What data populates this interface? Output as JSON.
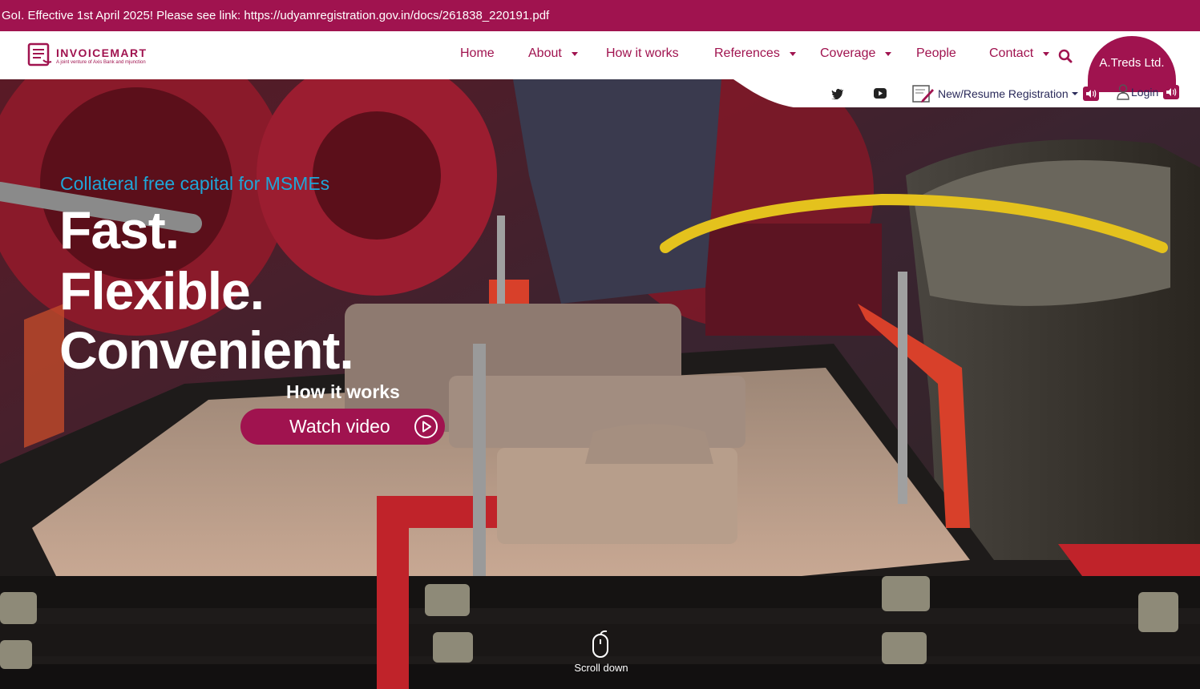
{
  "announcement": "GoI. Effective 1st April 2025! Please see link: https://udyamregistration.gov.in/docs/261838_220191.pdf",
  "logo": {
    "name": "INVOICEMART",
    "subtitle": "A joint venture of Axis Bank and mjunction"
  },
  "nav": {
    "items": [
      {
        "label": "Home",
        "dropdown": false
      },
      {
        "label": "About",
        "dropdown": true
      },
      {
        "label": "How it works",
        "dropdown": false
      },
      {
        "label": "References",
        "dropdown": true
      },
      {
        "label": "Coverage",
        "dropdown": true
      },
      {
        "label": "People",
        "dropdown": false
      },
      {
        "label": "Contact",
        "dropdown": true
      }
    ],
    "search_icon": "search-icon"
  },
  "brand_tab": "A.Treds Ltd.",
  "social": [
    "linkedin-icon",
    "twitter-icon",
    "facebook-icon",
    "youtube-icon"
  ],
  "registration": {
    "label": "New/Resume Registration",
    "icon": "edit-form-icon"
  },
  "login": {
    "label": "Login",
    "icon": "user-icon"
  },
  "hero": {
    "tagline": "Collateral free capital for MSMEs",
    "headline": [
      "Fast.",
      "Flexible.",
      "Convenient."
    ],
    "how_it_works": "How it works",
    "watch_button": "Watch video",
    "scroll_label": "Scroll down"
  },
  "colors": {
    "brand": "#a0134f",
    "accent": "#1fa6d8",
    "white": "#ffffff"
  }
}
